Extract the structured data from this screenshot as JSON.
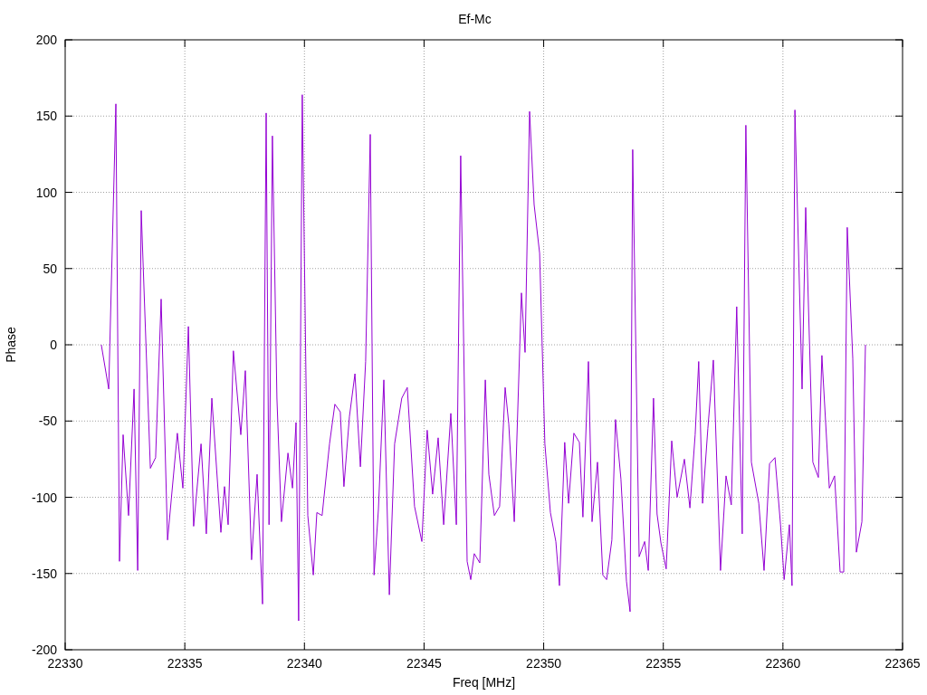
{
  "chart_data": {
    "type": "line",
    "title": "Ef-Mc",
    "xlabel": "Freq [MHz]",
    "ylabel": "Phase",
    "grid": true,
    "xlim": [
      22330,
      22365
    ],
    "ylim": [
      -200,
      200
    ],
    "xticks": [
      22330,
      22335,
      22340,
      22345,
      22350,
      22355,
      22360,
      22365
    ],
    "yticks": [
      -200,
      -150,
      -100,
      -50,
      0,
      50,
      100,
      150,
      200
    ],
    "x": [
      22331.51,
      22331.82,
      22332.12,
      22332.27,
      22332.42,
      22332.65,
      22332.88,
      22333.03,
      22333.18,
      22333.56,
      22333.78,
      22334.01,
      22334.28,
      22334.69,
      22334.92,
      22335.15,
      22335.37,
      22335.68,
      22335.9,
      22336.13,
      22336.51,
      22336.66,
      22336.81,
      22337.03,
      22337.34,
      22337.53,
      22337.79,
      22338.02,
      22338.25,
      22338.4,
      22338.52,
      22338.66,
      22338.85,
      22339.04,
      22339.31,
      22339.5,
      22339.65,
      22339.76,
      22339.91,
      22340.14,
      22340.37,
      22340.52,
      22340.74,
      22341.05,
      22341.27,
      22341.5,
      22341.65,
      22341.88,
      22342.11,
      22342.34,
      22342.56,
      22342.75,
      22342.91,
      22343.09,
      22343.32,
      22343.55,
      22343.77,
      22344.07,
      22344.3,
      22344.6,
      22344.91,
      22345.13,
      22345.36,
      22345.59,
      22345.82,
      22346.12,
      22346.35,
      22346.53,
      22346.8,
      22346.95,
      22347.1,
      22347.33,
      22347.56,
      22347.71,
      22347.94,
      22348.16,
      22348.39,
      22348.54,
      22348.77,
      22349.07,
      22349.22,
      22349.41,
      22349.6,
      22349.83,
      22350.05,
      22350.28,
      22350.51,
      22350.66,
      22350.88,
      22351.04,
      22351.26,
      22351.49,
      22351.64,
      22351.87,
      22352.02,
      22352.25,
      22352.47,
      22352.63,
      22352.85,
      22353.0,
      22353.23,
      22353.46,
      22353.61,
      22353.72,
      22353.99,
      22354.22,
      22354.37,
      22354.59,
      22354.74,
      22354.9,
      22355.12,
      22355.35,
      22355.58,
      22355.88,
      22356.11,
      22356.33,
      22356.48,
      22356.64,
      22356.86,
      22357.09,
      22357.39,
      22357.62,
      22357.84,
      22358.07,
      22358.3,
      22358.45,
      22358.68,
      22358.99,
      22359.21,
      22359.44,
      22359.67,
      22359.9,
      22360.05,
      22360.27,
      22360.38,
      22360.5,
      22360.8,
      22360.95,
      22361.25,
      22361.48,
      22361.63,
      22361.94,
      22362.16,
      22362.39,
      22362.54,
      22362.69,
      22362.92,
      22363.07,
      22363.3,
      22363.45
    ],
    "values": [
      0,
      -29,
      158,
      -142,
      -59,
      -112,
      -29,
      -148,
      88,
      -81,
      -74,
      30,
      -128,
      -58,
      -94,
      12,
      -119,
      -65,
      -124,
      -35,
      -123,
      -93,
      -118,
      -4,
      -59,
      -17,
      -141,
      -85,
      -170,
      152,
      -118,
      137,
      -35,
      -116,
      -71,
      -94,
      -51,
      -181,
      164,
      -112,
      -151,
      -110,
      -112,
      -65,
      -39,
      -44,
      -93,
      -47,
      -19,
      -80,
      -11,
      138,
      -151,
      -108,
      -23,
      -164,
      -65,
      -35,
      -28,
      -106,
      -129,
      -56,
      -98,
      -61,
      -118,
      -45,
      -118,
      124,
      -142,
      -154,
      -137,
      -143,
      -23,
      -85,
      -112,
      -106,
      -28,
      -52,
      -116,
      34,
      -5,
      153,
      92,
      60,
      -65,
      -110,
      -129,
      -158,
      -64,
      -104,
      -58,
      -64,
      -113,
      -11,
      -116,
      -77,
      -151,
      -154,
      -128,
      -49,
      -88,
      -155,
      -175,
      128,
      -139,
      -129,
      -148,
      -35,
      -111,
      -130,
      -147,
      -63,
      -100,
      -75,
      -107,
      -59,
      -11,
      -104,
      -55,
      -10,
      -148,
      -86,
      -105,
      25,
      -124,
      144,
      -77,
      -104,
      -148,
      -78,
      -74,
      -118,
      -154,
      -118,
      -158,
      154,
      -29,
      90,
      -77,
      -87,
      -7,
      -94,
      -86,
      -149,
      -149,
      77,
      -9,
      -136,
      -116,
      0
    ]
  }
}
